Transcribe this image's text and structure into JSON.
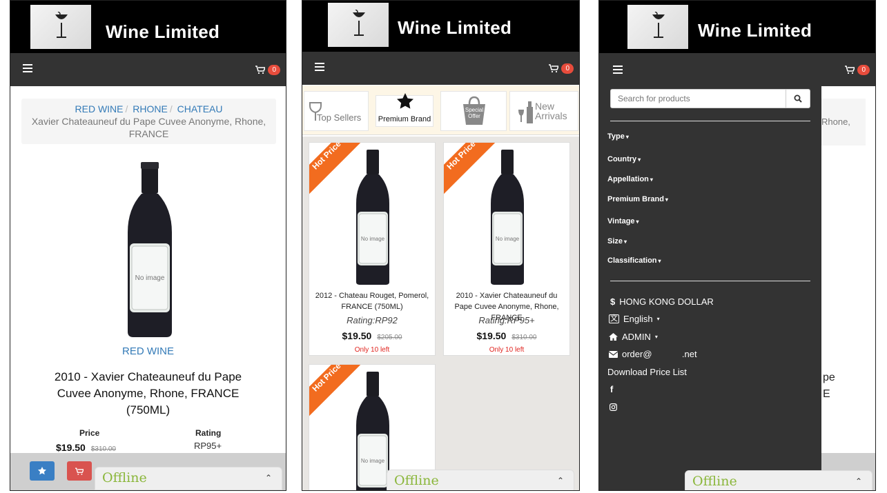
{
  "brand": {
    "name": "Wine Limited"
  },
  "cart": {
    "count": "0"
  },
  "detail": {
    "breadcrumb": [
      "RED WINE",
      "RHONE",
      "CHATEAU"
    ],
    "breadcrumb_current": "Xavier Chateauneuf du Pape Cuvee Anonyme, Rhone, FRANCE",
    "image_placeholder": "No image",
    "category": "RED WINE",
    "title": "2010 - Xavier Chateauneuf du Pape Cuvee Anonyme, Rhone, FRANCE (750ML)",
    "price_label": "Price",
    "price": "$19.50",
    "old_price": "$310.00",
    "rating_label": "Rating",
    "rating": "RP95+"
  },
  "chat": {
    "status": "Offline"
  },
  "categories": [
    {
      "label": "Top Sellers"
    },
    {
      "label": "Premium Brand"
    },
    {
      "label": "Special Offer"
    },
    {
      "label": "New Arrivals"
    }
  ],
  "products": [
    {
      "badge": "Hot Price",
      "image": "No image",
      "title": "2012 - Chateau Rouget, Pomerol, FRANCE (750ML)",
      "rating": "Rating:RP92",
      "price": "$19.50",
      "old_price": "$205.00",
      "stock": "Only 10 left"
    },
    {
      "badge": "Hot Price",
      "image": "No image",
      "title": "2010 - Xavier Chateauneuf du Pape Cuvee Anonyme, Rhone, FRANCE",
      "rating": "Rating:RP95+",
      "price": "$19.50",
      "old_price": "$310.00",
      "stock": "Only 10 left"
    },
    {
      "badge": "Hot Price",
      "image": "No image"
    }
  ],
  "menu": {
    "search_placeholder": "Search for products",
    "filters": [
      "Type",
      "Country",
      "Appellation",
      "Premium Brand",
      "Vintage",
      "Size",
      "Classification"
    ],
    "currency": "HONG KONG DOLLAR",
    "language": "English",
    "account": "ADMIN",
    "email": "order@            .net",
    "download": "Download Price List"
  },
  "peek": {
    "a": "Rhone,",
    "b": "pe",
    "c": "E"
  },
  "colors": {
    "accent": "#337ab7",
    "badge": "#e74c3c",
    "hot": "#f26c1f",
    "offline": "#8ab63a",
    "navbar": "#333333"
  }
}
